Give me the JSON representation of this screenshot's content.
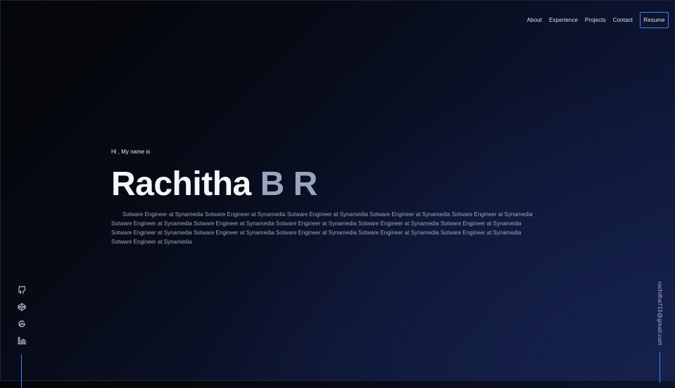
{
  "nav": {
    "items": [
      {
        "label": "About"
      },
      {
        "label": "Experience"
      },
      {
        "label": "Projects"
      },
      {
        "label": "Contact"
      }
    ],
    "resume_label": "Resume"
  },
  "hero": {
    "greeting": "Hi , My name is",
    "name_first": "Rachitha",
    "name_last": "B R",
    "bio": "Sotware Engineer at Synamedia Sotware Engineer at Synamedia Sotware Engineer at Synamedia Sotware Engineer at Synamedia Sotware Engineer at Synamedia Sotware Engineer at Synamedia Sotware Engineer at Synamedia Sotware Engineer at Synamedia Sotware Engineer at Synamedia Sotware Engineer at Synamedia Sotware Engineer at Synamedia Sotware Engineer at Synamedia Sotware Engineer at Synamedia Sotware Engineer at Synamedia Sotware Engineer at Synamedia Sotware Engineer at Synamedia"
  },
  "social": {
    "icons": [
      "github-icon",
      "codepen-icon",
      "gatsby-icon",
      "linkedin-icon"
    ]
  },
  "email": "rachitha715@gmail.com",
  "colors": {
    "accent": "#3b82f6",
    "background_dark": "#050609",
    "background_navy": "#121c44",
    "name_primary": "#f5f6f8",
    "name_secondary": "#97a6be"
  }
}
